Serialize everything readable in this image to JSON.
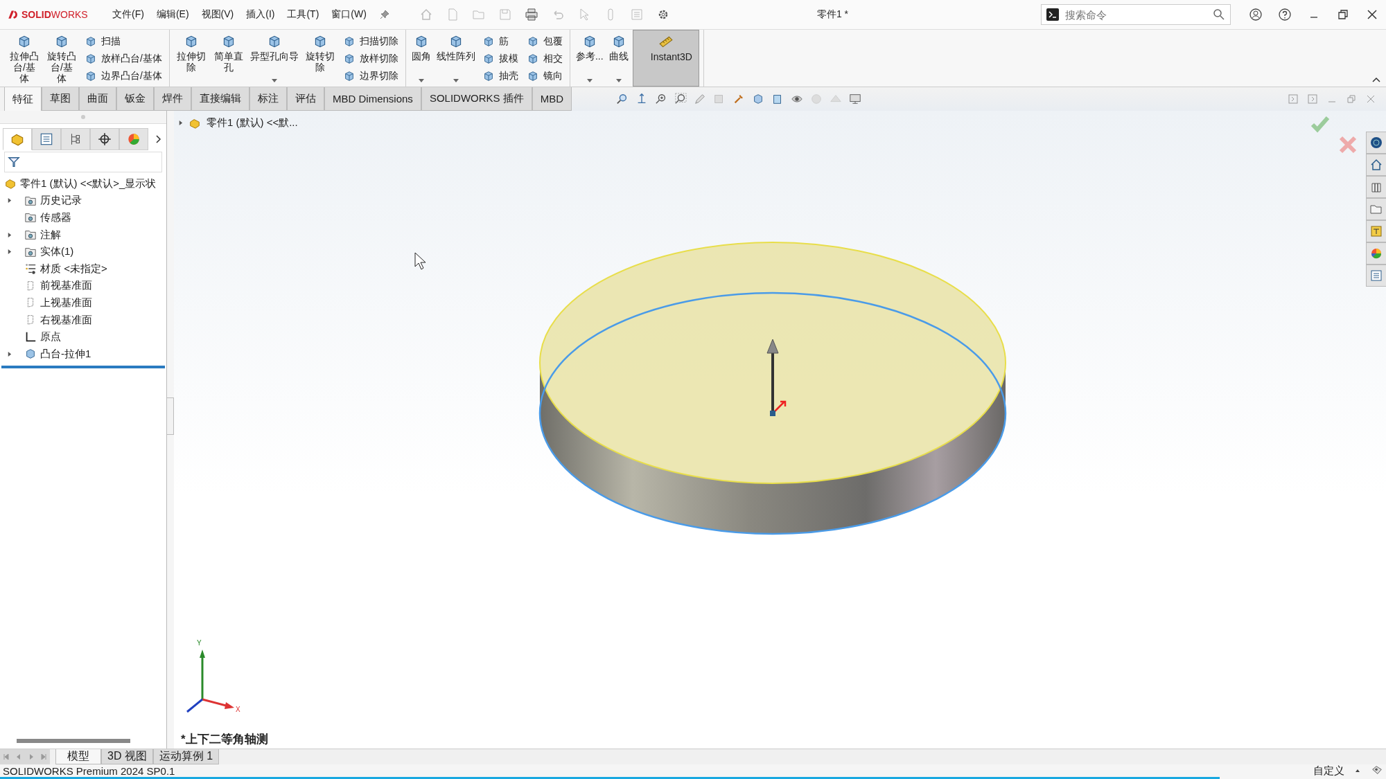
{
  "title_bar": {
    "logo": "**SOLID**WORKS",
    "menus": [
      "文件(F)",
      "编辑(E)",
      "视图(V)",
      "插入(I)",
      "工具(T)",
      "窗口(W)"
    ],
    "document_title": "零件1 *",
    "search": {
      "placeholder": "搜索命令"
    }
  },
  "ribbon": {
    "groups": [
      {
        "items": [
          {
            "kind": "large",
            "label": "拉伸凸台/基体"
          },
          {
            "kind": "large",
            "label": "旋转凸台/基体"
          },
          {
            "kind": "column",
            "entries": [
              "扫描",
              "放样凸台/基体",
              "边界凸台/基体"
            ]
          }
        ]
      },
      {
        "items": [
          {
            "kind": "large",
            "label": "拉伸切除"
          },
          {
            "kind": "large",
            "label": "简单直孔"
          },
          {
            "kind": "large",
            "label": "异型孔向导",
            "menu": true
          },
          {
            "kind": "large",
            "label": "旋转切除"
          },
          {
            "kind": "column",
            "entries": [
              "扫描切除",
              "放样切除",
              "边界切除"
            ]
          }
        ]
      },
      {
        "items": [
          {
            "kind": "large",
            "label": "圆角",
            "menu": true
          },
          {
            "kind": "large",
            "label": "线性阵列",
            "menu": true
          },
          {
            "kind": "column",
            "entries": [
              "筋",
              "拔模",
              "抽壳"
            ]
          },
          {
            "kind": "column",
            "entries": [
              "包覆",
              "相交",
              "镜向"
            ]
          }
        ]
      },
      {
        "items": [
          {
            "kind": "large",
            "label": "参考...",
            "menu": true
          },
          {
            "kind": "large",
            "label": "曲线",
            "menu": true
          },
          {
            "kind": "toggle",
            "label": "Instant3D",
            "on": true
          }
        ]
      }
    ]
  },
  "command_tabs": [
    {
      "label": "特征",
      "selected": true
    },
    {
      "label": "草图",
      "selected": false
    },
    {
      "label": "曲面",
      "selected": false
    },
    {
      "label": "钣金",
      "selected": false
    },
    {
      "label": "焊件",
      "selected": false
    },
    {
      "label": "直接编辑",
      "selected": false
    },
    {
      "label": "标注",
      "selected": false
    },
    {
      "label": "评估",
      "selected": false
    },
    {
      "label": "MBD Dimensions",
      "selected": false
    },
    {
      "label": "SOLIDWORKS 插件",
      "selected": false
    },
    {
      "label": "MBD",
      "selected": false
    }
  ],
  "feature_manager": {
    "tree": {
      "label": "零件1 (默认) <<默认>_显示状",
      "children": [
        {
          "label": "历史记录",
          "kind": "folder",
          "expanded": false
        },
        {
          "label": "传感器",
          "kind": "folder"
        },
        {
          "label": "注解",
          "kind": "folder",
          "expanded": false
        },
        {
          "label": "实体(1)",
          "kind": "folder",
          "expanded": false
        },
        {
          "label": "材质 <未指定>",
          "kind": "material"
        },
        {
          "label": "前视基准面",
          "kind": "plane"
        },
        {
          "label": "上视基准面",
          "kind": "plane"
        },
        {
          "label": "右视基准面",
          "kind": "plane"
        },
        {
          "label": "原点",
          "kind": "origin"
        },
        {
          "label": "凸台-拉伸1",
          "kind": "feature",
          "expanded": false
        }
      ]
    }
  },
  "viewport": {
    "breadcrumb": "零件1 (默认) <<默...",
    "view_orientation": "*上下二等角轴测",
    "triad": {
      "x": "X",
      "y": "Y"
    }
  },
  "bottom_tabs": [
    {
      "label": "模型",
      "selected": true
    },
    {
      "label": "3D 视图",
      "selected": false
    },
    {
      "label": "运动算例 1",
      "selected": false
    }
  ],
  "status_bar": {
    "product": "SOLIDWORKS Premium 2024 SP0.1",
    "units": "自定义"
  }
}
